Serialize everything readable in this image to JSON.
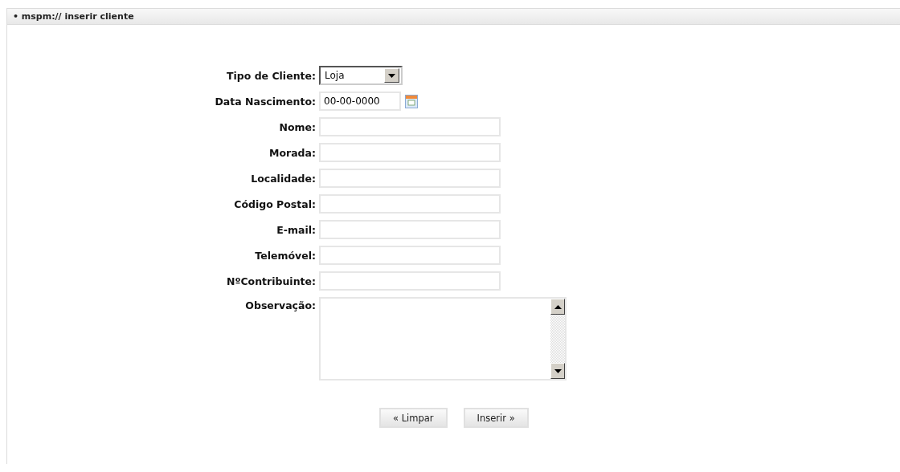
{
  "panel": {
    "title": "• mspm:// inserir cliente"
  },
  "fields": [
    {
      "label": "Tipo de Cliente:",
      "kind": "select",
      "value": "Loja"
    },
    {
      "label": "Data Nascimento:",
      "kind": "date",
      "value": "00-00-0000"
    },
    {
      "label": "Nome:",
      "kind": "text"
    },
    {
      "label": "Morada:",
      "kind": "text"
    },
    {
      "label": "Localidade:",
      "kind": "text"
    },
    {
      "label": "Código Postal:",
      "kind": "text"
    },
    {
      "label": "E-mail:",
      "kind": "text"
    },
    {
      "label": "Telemóvel:",
      "kind": "text"
    },
    {
      "label": "NºContribuinte:",
      "kind": "text"
    },
    {
      "label": "Observação:",
      "kind": "textarea"
    }
  ],
  "buttons": [
    "« Limpar",
    "Inserir »"
  ]
}
